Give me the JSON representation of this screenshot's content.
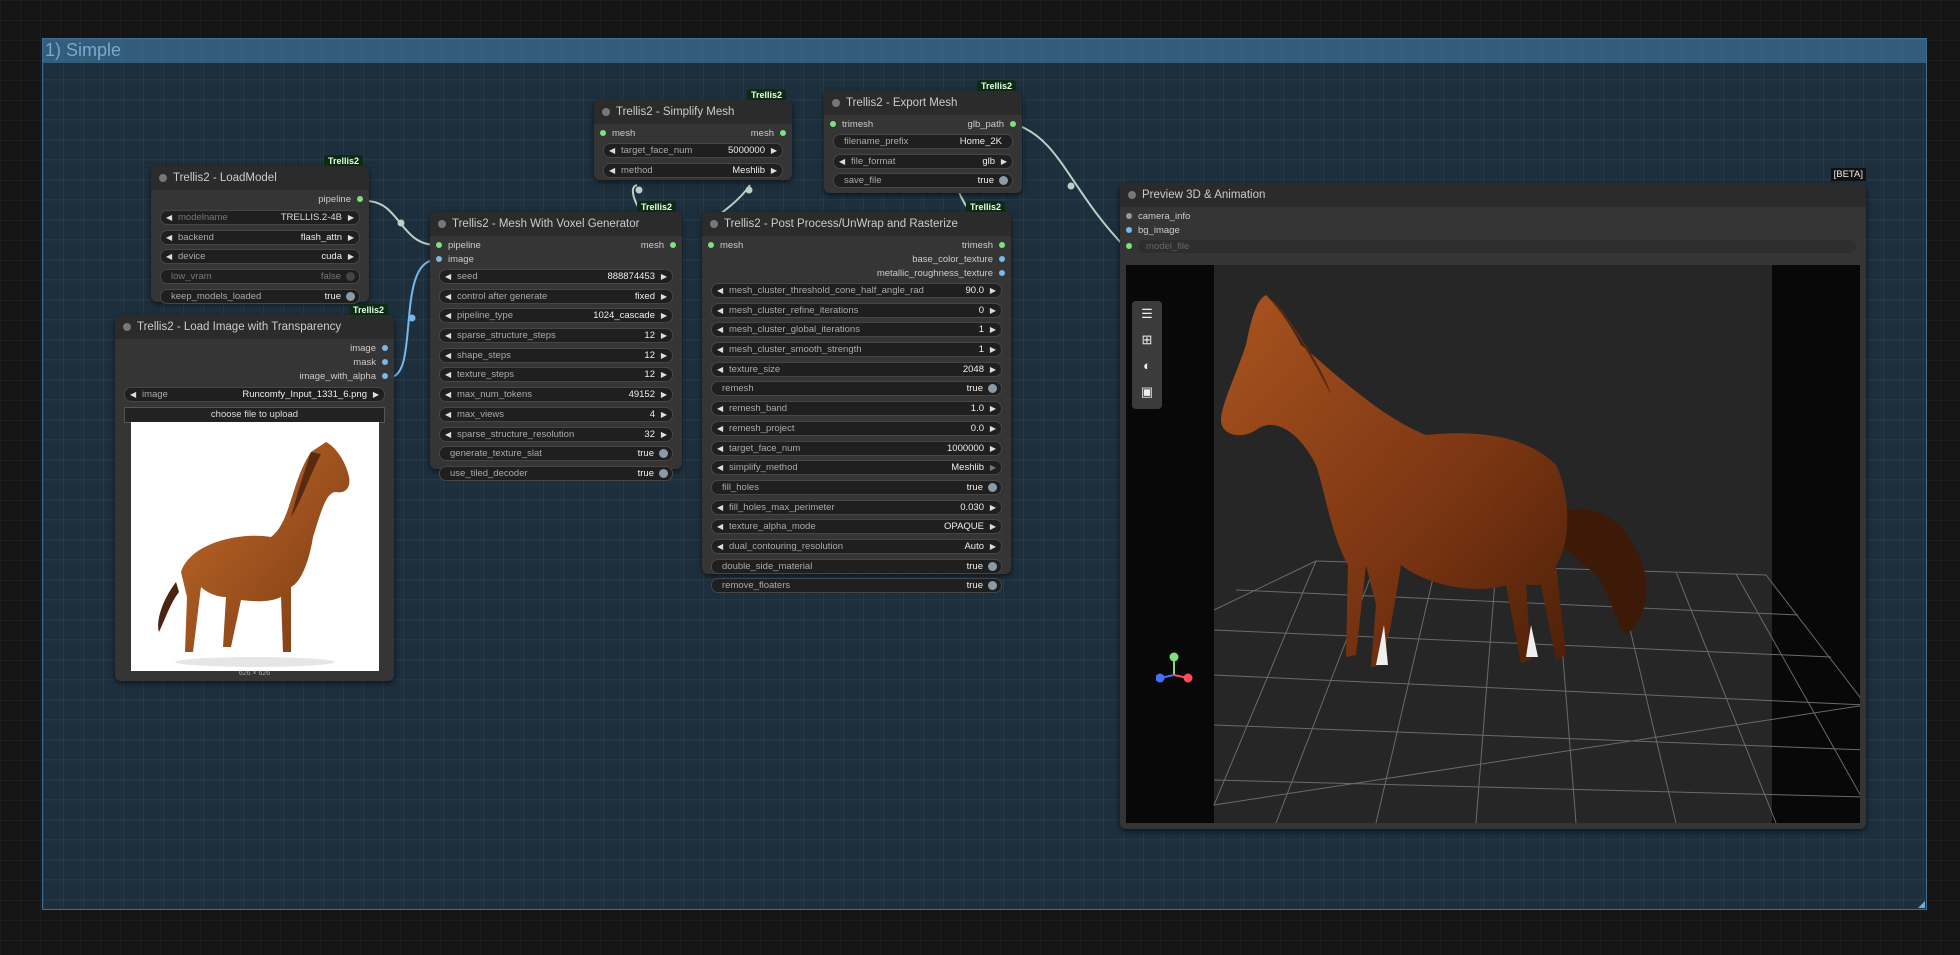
{
  "group": {
    "title": "1) Simple"
  },
  "nodes": {
    "load_model": {
      "title": "Trellis2 - LoadModel",
      "badge": "Trellis2",
      "output": "pipeline",
      "widgets": [
        {
          "label": "modelname",
          "value": "TRELLIS.2-4B"
        },
        {
          "label": "backend",
          "value": "flash_attn"
        },
        {
          "label": "device",
          "value": "cuda"
        },
        {
          "label": "low_vram",
          "value": "false"
        },
        {
          "label": "keep_models_loaded",
          "value": "true"
        }
      ]
    },
    "load_image": {
      "title": "Trellis2 - Load Image with Transparency",
      "badge": "Trellis2",
      "outputs": [
        "image",
        "mask",
        "image_with_alpha"
      ],
      "image_widget": {
        "label": "image",
        "value": "Runcomfy_Input_1331_6.png"
      },
      "upload_button": "choose file to upload",
      "dimensions": "626 × 626"
    },
    "voxel": {
      "title": "Trellis2 - Mesh With Voxel Generator",
      "badge": "Trellis2",
      "inputs": [
        "pipeline",
        "image"
      ],
      "output": "mesh",
      "widgets": [
        {
          "label": "seed",
          "value": "888874453"
        },
        {
          "label": "control after generate",
          "value": "fixed"
        },
        {
          "label": "pipeline_type",
          "value": "1024_cascade"
        },
        {
          "label": "sparse_structure_steps",
          "value": "12"
        },
        {
          "label": "shape_steps",
          "value": "12"
        },
        {
          "label": "texture_steps",
          "value": "12"
        },
        {
          "label": "max_num_tokens",
          "value": "49152"
        },
        {
          "label": "max_views",
          "value": "4"
        },
        {
          "label": "sparse_structure_resolution",
          "value": "32"
        },
        {
          "label": "generate_texture_slat",
          "value": "true"
        },
        {
          "label": "use_tiled_decoder",
          "value": "true"
        }
      ]
    },
    "simplify": {
      "title": "Trellis2 - Simplify Mesh",
      "badge": "Trellis2",
      "input": "mesh",
      "output": "mesh",
      "widgets": [
        {
          "label": "target_face_num",
          "value": "5000000"
        },
        {
          "label": "method",
          "value": "Meshlib"
        }
      ]
    },
    "export": {
      "title": "Trellis2 - Export Mesh",
      "badge": "Trellis2",
      "input": "trimesh",
      "output": "glb_path",
      "widgets": [
        {
          "label": "filename_prefix",
          "value": "Home_2K"
        },
        {
          "label": "file_format",
          "value": "glb"
        },
        {
          "label": "save_file",
          "value": "true"
        }
      ]
    },
    "postprocess": {
      "title": "Trellis2 - Post Process/UnWrap and Rasterize",
      "badge": "Trellis2",
      "input": "mesh",
      "outputs": [
        "trimesh",
        "base_color_texture",
        "metallic_roughness_texture"
      ],
      "widgets": [
        {
          "label": "mesh_cluster_threshold_cone_half_angle_rad",
          "value": "90.0"
        },
        {
          "label": "mesh_cluster_refine_iterations",
          "value": "0"
        },
        {
          "label": "mesh_cluster_global_iterations",
          "value": "1"
        },
        {
          "label": "mesh_cluster_smooth_strength",
          "value": "1"
        },
        {
          "label": "texture_size",
          "value": "2048"
        },
        {
          "label": "remesh",
          "value": "true"
        },
        {
          "label": "remesh_band",
          "value": "1.0"
        },
        {
          "label": "remesh_project",
          "value": "0.0"
        },
        {
          "label": "target_face_num",
          "value": "1000000"
        },
        {
          "label": "simplify_method",
          "value": "Meshlib"
        },
        {
          "label": "fill_holes",
          "value": "true"
        },
        {
          "label": "fill_holes_max_perimeter",
          "value": "0.030"
        },
        {
          "label": "texture_alpha_mode",
          "value": "OPAQUE"
        },
        {
          "label": "dual_contouring_resolution",
          "value": "Auto"
        },
        {
          "label": "double_side_material",
          "value": "true"
        },
        {
          "label": "remove_floaters",
          "value": "true"
        }
      ]
    },
    "preview": {
      "title": "Preview 3D & Animation",
      "badge": "[BETA]",
      "inputs": [
        "camera_info",
        "bg_image",
        "model_file"
      ],
      "toolbar_icons": [
        "menu-icon",
        "grid-icon",
        "palette-icon",
        "image-icon"
      ]
    }
  },
  "colors": {
    "mesh_link": "#b5d3c6",
    "image_link": "#7ab6e8",
    "group_border": "#3e6e93",
    "badge_bg": "#0c2b12"
  }
}
